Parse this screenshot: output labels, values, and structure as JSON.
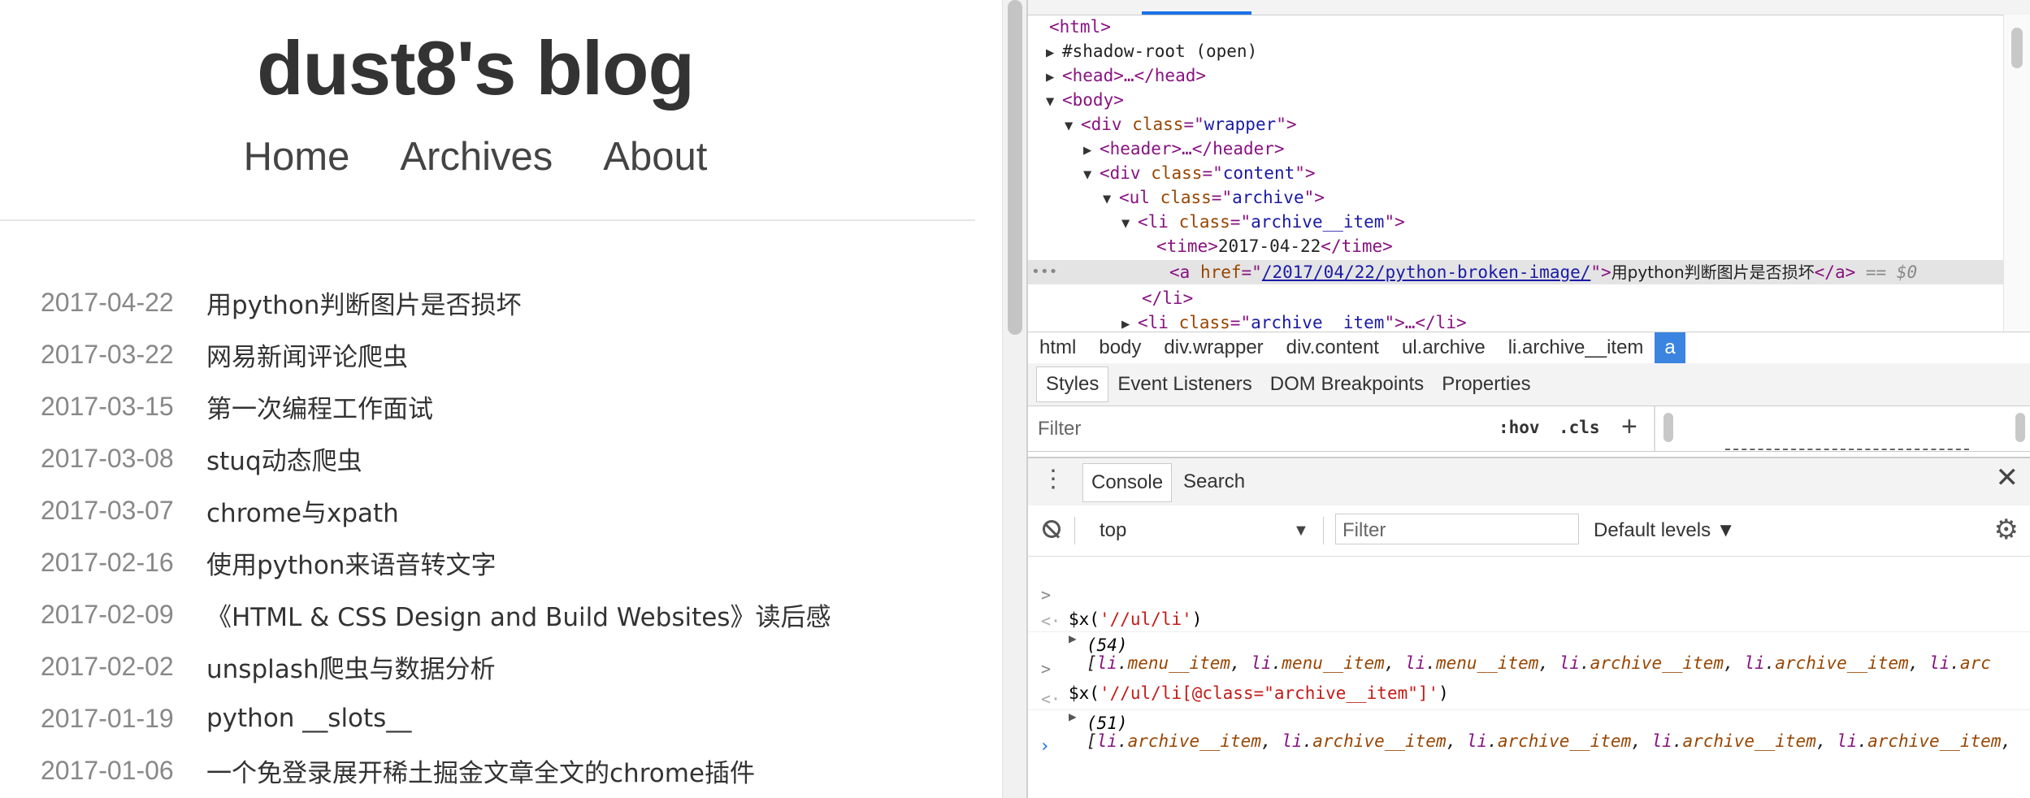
{
  "blog": {
    "title": "dust8's blog",
    "nav": [
      "Home",
      "Archives",
      "About"
    ],
    "archive": [
      {
        "date": "2017-04-22",
        "title": "用python判断图片是否损坏"
      },
      {
        "date": "2017-03-22",
        "title": "网易新闻评论爬虫"
      },
      {
        "date": "2017-03-15",
        "title": "第一次编程工作面试"
      },
      {
        "date": "2017-03-08",
        "title": "stuq动态爬虫"
      },
      {
        "date": "2017-03-07",
        "title": "chrome与xpath"
      },
      {
        "date": "2017-02-16",
        "title": "使用python来语音转文字"
      },
      {
        "date": "2017-02-09",
        "title": "《HTML & CSS Design and Build Websites》读后感"
      },
      {
        "date": "2017-02-02",
        "title": "unsplash爬虫与数据分析"
      },
      {
        "date": "2017-01-19",
        "title": "python __slots__"
      },
      {
        "date": "2017-01-06",
        "title": "一个免登录展开稀土掘金文章全文的chrome插件"
      }
    ]
  },
  "devtools": {
    "dom": {
      "html_open": "<html>",
      "shadow": "#shadow-root (open)",
      "head": "<head>…</head>",
      "body": "<body>",
      "wrapper_open": "<div class=\"wrapper\">",
      "header": "<header>…</header>",
      "content_open": "<div class=\"content\">",
      "ul_open": "<ul class=\"archive\">",
      "li_open": "<li class=\"archive__item\">",
      "time": "<time>2017-04-22</time>",
      "a_href": "/2017/04/22/python-broken-image/",
      "a_text": "用python判断图片是否损坏",
      "a_suffix": "== $0",
      "li_close": "</li>",
      "li_collapsed": "<li class=\"archive__item\">…</li>"
    },
    "breadcrumb": [
      "html",
      "body",
      "div.wrapper",
      "div.content",
      "ul.archive",
      "li.archive__item",
      "a"
    ],
    "styles_tabs": [
      "Styles",
      "Event Listeners",
      "DOM Breakpoints",
      "Properties"
    ],
    "filter_placeholder": "Filter",
    "hov": ":hov",
    "cls": ".cls",
    "drawer_tabs": [
      "Console",
      "Search"
    ],
    "console_context": "top",
    "console_filter_placeholder": "Filter",
    "console_levels": "Default levels",
    "console": [
      {
        "type": "cmd",
        "text": "$x('//ul/li')"
      },
      {
        "type": "count",
        "text": "(54)"
      },
      {
        "type": "result",
        "items": [
          "li.menu__item",
          "li.menu__item",
          "li.menu__item",
          "li.archive__item",
          "li.archive__item",
          "li.arc"
        ]
      },
      {
        "type": "cmd",
        "text": "$x('//ul/li[@class=\"archive__item\"]')"
      },
      {
        "type": "count",
        "text": "(51)"
      },
      {
        "type": "result",
        "items": [
          "li.archive__item",
          "li.archive__item",
          "li.archive__item",
          "li.archive__item",
          "li.archive__item"
        ]
      }
    ]
  },
  "colors": {
    "accent": "#1a73e8",
    "tag": "#881280",
    "attr": "#994500",
    "value": "#1a1aa6",
    "string": "#c41a16",
    "breadcrumb_selected": "#3b84e0"
  }
}
